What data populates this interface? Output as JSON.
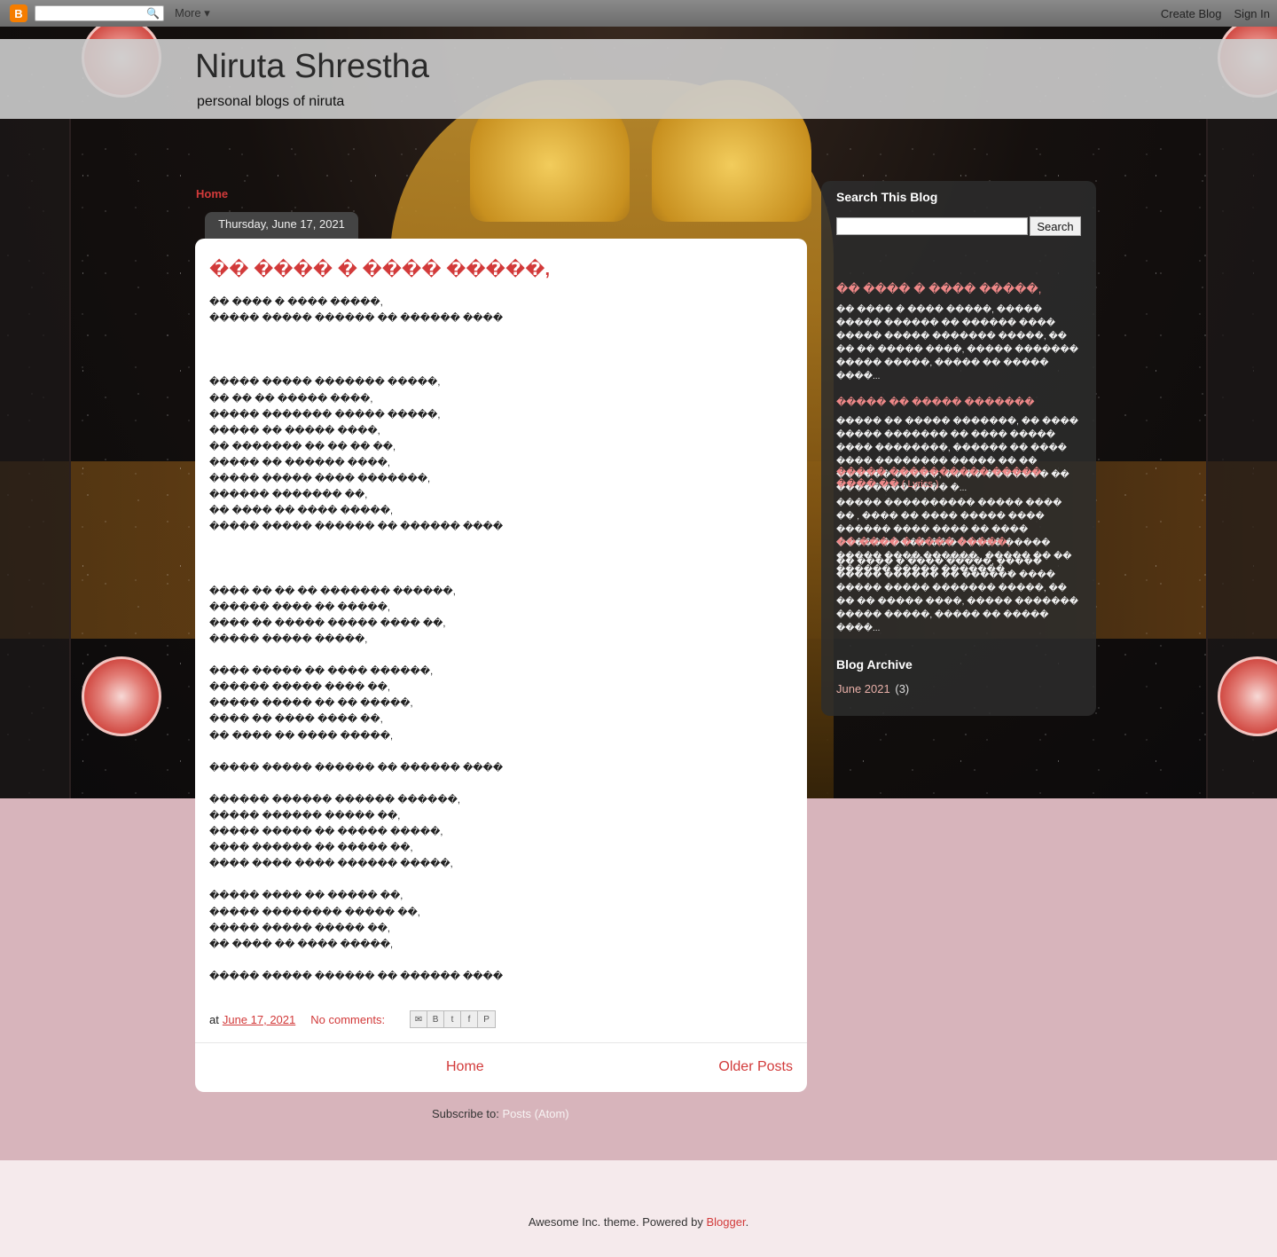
{
  "navbar": {
    "more_label": "More",
    "create_blog": "Create Blog",
    "sign_in": "Sign In"
  },
  "header": {
    "title": "Niruta Shrestha",
    "description": "personal blogs of niruta"
  },
  "main": {
    "home_link": "Home",
    "date": "Thursday, June 17, 2021",
    "post": {
      "title": "�� ���� � ���� �����,",
      "lines": [
        "�� ���� � ���� �����,",
        "����� ����� ������ �� ������ ����",
        "",
        "",
        "",
        "����� ����� ������� �����,",
        "�� �� �� ����� ����,",
        "����� ������� ����� �����,",
        "����� �� ����� ����,",
        "�� ������� �� �� �� ��,",
        "����� �� ������ ����,",
        "����� ����� ���� �������,",
        "������ ������� ��,",
        "�� ���� �� ���� �����,",
        "����� ����� ������ �� ������ ����",
        "",
        "",
        "",
        "���� �� �� �� ������� ������,",
        "������ ���� �� �����,",
        "���� �� ����� ����� ���� ��,",
        "����� ����� �����,",
        "",
        "���� ����� �� ���� ������,",
        "������ ����� ���� ��,",
        "����� ����� �� �� �����,",
        "���� �� ���� ���� ��,",
        "�� ���� �� ���� �����,",
        "",
        "����� ����� ������ �� ������ ����",
        "",
        "������ ������ ������ ������,",
        "����� ������ ����� ��,",
        "����� ����� �� ����� �����,",
        "���� ������ �� ����� ��,",
        "���� ���� ���� ������ �����,",
        "",
        "����� ���� �� ����� ��,",
        "����� �������� ����� ��,",
        "����� ����� ����� ��,",
        "�� ���� �� ���� �����,",
        "",
        "����� ����� ������ �� ������ ����"
      ],
      "footer": {
        "at": "at",
        "date": "June 17, 2021",
        "comments": "No comments:"
      }
    },
    "pager": {
      "home": "Home",
      "older": "Older Posts"
    },
    "subscribe": {
      "label": "Subscribe to:",
      "link": "Posts (Atom)"
    }
  },
  "sidebar": {
    "search": {
      "heading": "Search This Blog",
      "button": "Search"
    },
    "popular": [
      {
        "title": "�� ���� � ���� �����,",
        "snippet": "�� ���� � ���� �����, ����� ����� ������ �� ������ ����   ����� ����� ������� �����, �� �� �� ����� ����, ����� ������� ����� �����, ����� �� ����� ����..."
      },
      {
        "title": "����� �� ����� �������",
        "snippet": "����� �� ����� �������, �� ���� ����� ������� �� ���� ����� ���� ��������, ������ �� ���� ���� �������� ����� �� �� ������ �����, �� �� ������� �� �������� ���� �..."
      },
      {
        "title": "����� ���������� ����� ���� �� ( Lyrics )",
        "snippet": "����� ���������� ����� ���� �� , ���� �� ���� �����  ���� ������ ���� ���� �� ���� ���������� ��������  ����� ����� ���� ������ , ����� �� �� ������  ����� ������� ..."
      },
      {
        "title": "�� ���� � ���� �����,",
        "snippet": "�� ���� � ���� �����, ����� ����� ������ �� ������ ����   ����� ����� ������� �����, �� �� �� ����� ����, ����� ������� ����� �����, ����� �� ����� ����..."
      }
    ],
    "archive": {
      "heading": "Blog Archive",
      "month": "June 2021",
      "count": "(3)"
    }
  },
  "footer": {
    "text": "Awesome Inc. theme. Powered by",
    "link": "Blogger",
    "period": "."
  },
  "colors": {
    "link_red": "#d23a3a",
    "navbar_gray": "#757575",
    "pink_bg": "#d7b4bb",
    "footer_bg": "#f5eaec",
    "sidebar_bg": "#2d2d2d"
  }
}
